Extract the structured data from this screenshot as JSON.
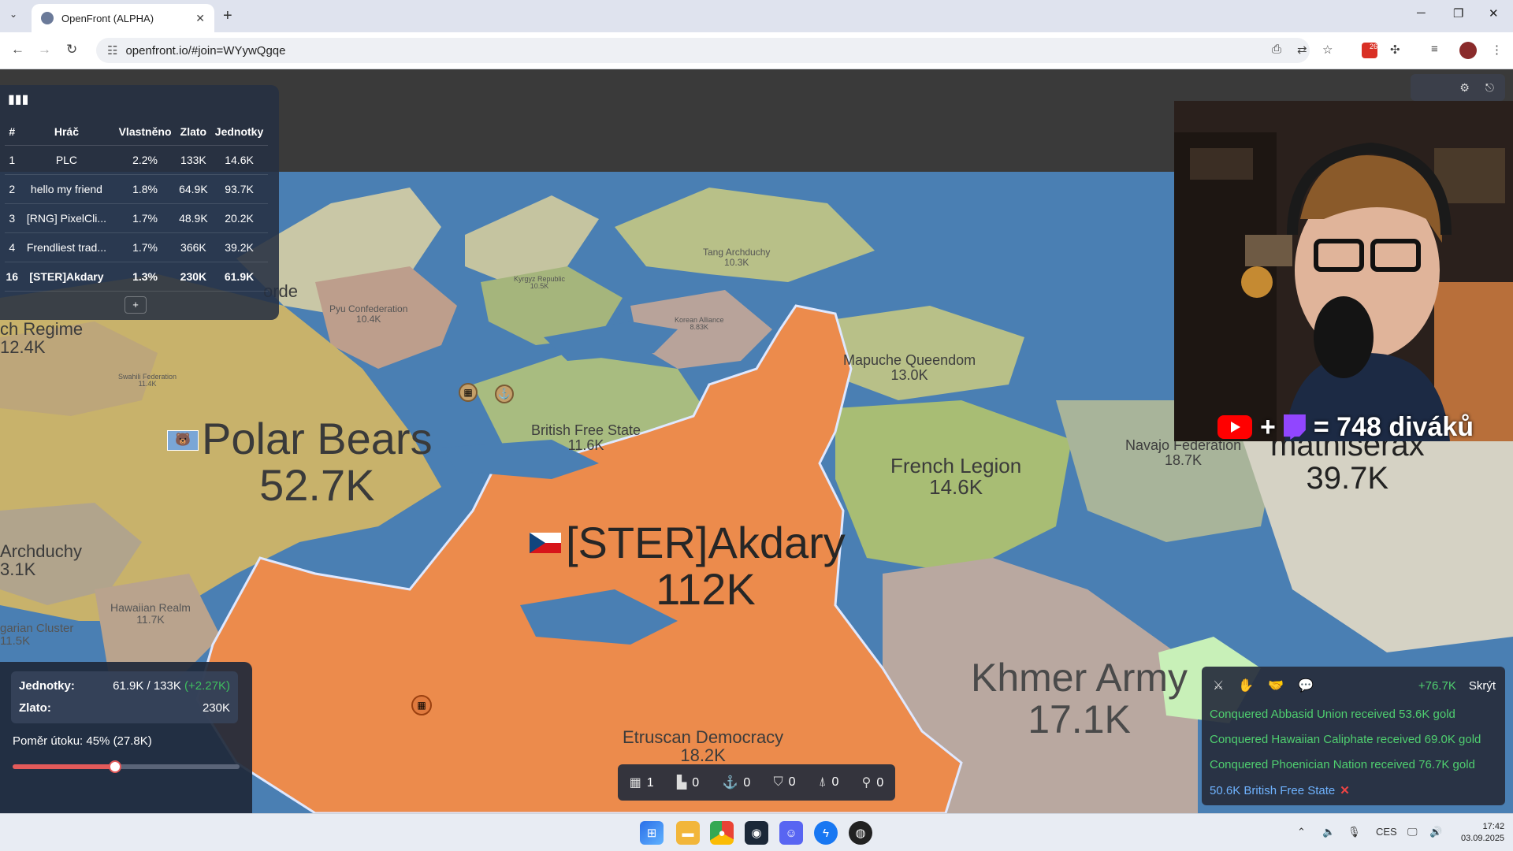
{
  "browser": {
    "tab_title": "OpenFront (ALPHA)",
    "url": "openfront.io/#join=WYywQgqe",
    "extension_badge": "26"
  },
  "leaderboard": {
    "headers": [
      "#",
      "Hráč",
      "Vlastněno",
      "Zlato",
      "Jednotky"
    ],
    "rows": [
      {
        "rank": "1",
        "name": "PLC",
        "owned": "2.2%",
        "gold": "133K",
        "units": "14.6K"
      },
      {
        "rank": "2",
        "name": "hello my friend",
        "owned": "1.8%",
        "gold": "64.9K",
        "units": "93.7K"
      },
      {
        "rank": "3",
        "name": "[RNG] PixelCli...",
        "owned": "1.7%",
        "gold": "48.9K",
        "units": "20.2K"
      },
      {
        "rank": "4",
        "name": "Frendliest trad...",
        "owned": "1.7%",
        "gold": "366K",
        "units": "39.2K"
      },
      {
        "rank": "16",
        "name": "[STER]Akdary",
        "owned": "1.3%",
        "gold": "230K",
        "units": "61.9K"
      }
    ],
    "expand_label": "+"
  },
  "map_labels": {
    "player": {
      "name": "[STER]Akdary",
      "value": "112K"
    },
    "polar": {
      "name": "Polar Bears",
      "value": "52.7K"
    },
    "khmer": {
      "name": "Khmer Army",
      "value": "17.1K"
    },
    "mathiserax": {
      "name": "mathiserax",
      "value": "39.7K"
    },
    "french": {
      "name": "French Legion",
      "value": "14.6K"
    },
    "mapuche": {
      "name": "Mapuche Queendom",
      "value": "13.0K"
    },
    "british": {
      "name": "British Free State",
      "value": "11.6K"
    },
    "etruscan": {
      "name": "Etruscan Democracy",
      "value": "18.2K"
    },
    "navajo": {
      "name": "Navajo Federation",
      "value": "18.7K"
    },
    "regime": {
      "name": "ch Regime",
      "value": "12.4K"
    },
    "archduchy": {
      "name": "Archduchy",
      "value": "3.1K"
    },
    "hawaiian": {
      "name": "Hawaiian Realm",
      "value": "11.7K"
    },
    "cluster": {
      "name": "garian Cluster",
      "value": "11.5K"
    },
    "tang": {
      "name": "Tang Archduchy",
      "value": "10.3K"
    },
    "pyu": {
      "name": "Pyu Confederation",
      "value": "10.4K"
    },
    "orde": {
      "name": "orde",
      "value": ""
    },
    "kyrgyz": {
      "name": "Kyrgyz Republic",
      "value": "10.5K"
    },
    "korean": {
      "name": "Korean Alliance",
      "value": "8.83K"
    },
    "swahili": {
      "name": "Swahili Federation",
      "value": "11.4K"
    }
  },
  "stats": {
    "units_label": "Jednotky:",
    "units_value": "61.9K / 133K",
    "units_gain": "(+2.27K)",
    "gold_label": "Zlato:",
    "gold_value": "230K",
    "attack_ratio_text": "Poměr útoku: 45% (27.8K)",
    "attack_ratio": 0.45
  },
  "unit_bar": [
    {
      "icon": "city-icon",
      "glyph": "▦",
      "count": "1"
    },
    {
      "icon": "factory-icon",
      "glyph": "▙",
      "count": "0"
    },
    {
      "icon": "port-icon",
      "glyph": "⚓",
      "count": "0"
    },
    {
      "icon": "defense-icon",
      "glyph": "⛉",
      "count": "0"
    },
    {
      "icon": "missile-icon",
      "glyph": "⍋",
      "count": "0"
    },
    {
      "icon": "sam-icon",
      "glyph": "⚲",
      "count": "0"
    }
  ],
  "events": {
    "total": "+76.7K",
    "hide_label": "Skrýt",
    "messages": [
      "Conquered Abbasid Union received 53.6K gold",
      "Conquered Hawaiian Caliphate received 69.0K gold",
      "Conquered Phoenician Nation received 76.7K gold"
    ],
    "incoming": "50.6K British Free State"
  },
  "stream": {
    "plus": "+",
    "viewers": "= 748 diváků"
  },
  "taskbar": {
    "lang": "CES",
    "time": "17:42",
    "date": "03.09.2025"
  },
  "colors": {
    "player_territory": "#ec8b4c",
    "ocean": "#4a7fb3",
    "panel": "#26303f",
    "positive": "#4fcf6f"
  }
}
